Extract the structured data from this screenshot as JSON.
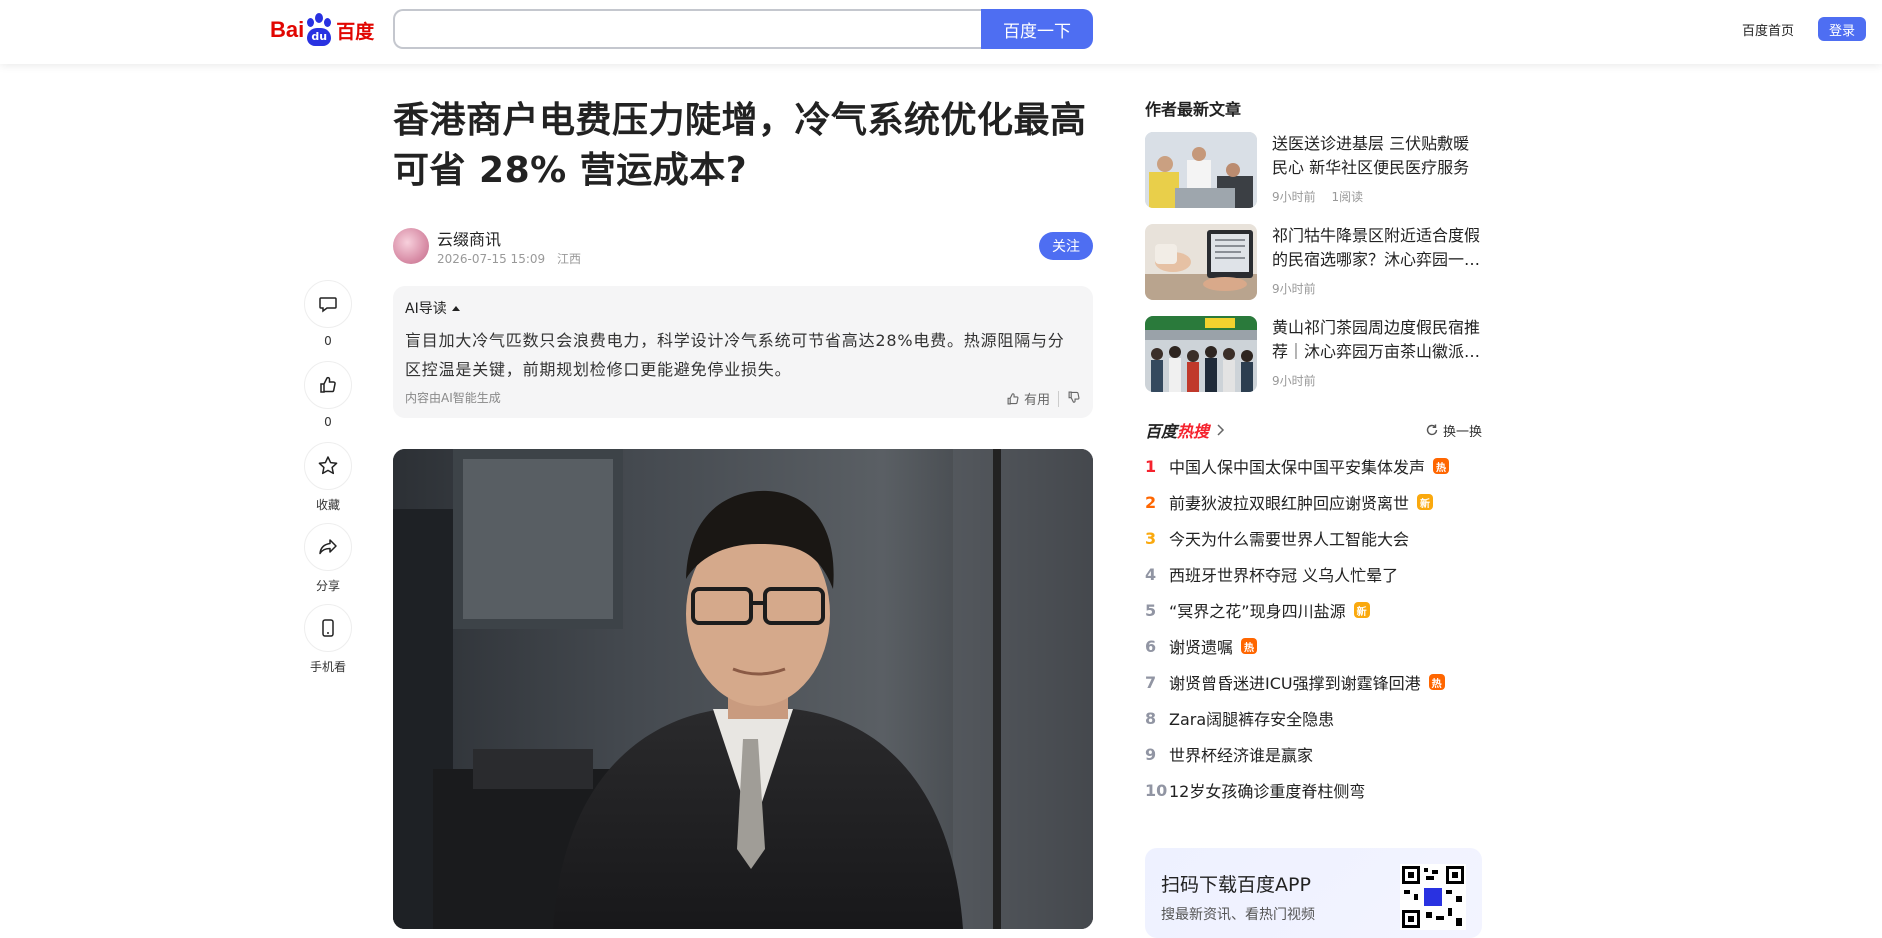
{
  "header": {
    "logo_text_left": "Bai",
    "logo_text_paw": "du",
    "logo_text_cn": "百度",
    "search_placeholder": "",
    "search_button": "百度一下",
    "home_link": "百度首页",
    "login_button": "登录"
  },
  "rail": [
    {
      "name": "comment",
      "label": "0"
    },
    {
      "name": "like",
      "label": "0"
    },
    {
      "name": "favorite",
      "label": "收藏"
    },
    {
      "name": "share",
      "label": "分享"
    },
    {
      "name": "mobile",
      "label": "手机看"
    }
  ],
  "article": {
    "title": "香港商户电费压力陡增，冷气系统优化最高可省 28% 营运成本?",
    "author": "云缀商讯",
    "date": "2026-07-15 15:09",
    "location": "江西",
    "follow_button": "关注",
    "ai": {
      "heading": "AI导读",
      "summary": "盲目加大冷气匹数只会浪费电力，科学设计冷气系统可节省高达28%电费。热源阻隔与分区控温是关键，前期规划检修口更能避免停业损失。",
      "footer": "内容由AI智能生成",
      "useful": "有用"
    }
  },
  "sidebar": {
    "latest_heading": "作者最新文章",
    "latest": [
      {
        "title": "送医送诊进基层 三伏贴敷暖民心 新华社区便民医疗服务",
        "time": "9小时前",
        "reads": "1阅读"
      },
      {
        "title": "祁门牯牛降景区附近适合度假的民宿选哪家？沐心弈园一站式",
        "time": "9小时前",
        "reads": ""
      },
      {
        "title": "黄山祁门茶园周边度假民宿推荐｜沐心弈园万亩茶山徽派民宿",
        "time": "9小时前",
        "reads": ""
      }
    ],
    "hot": {
      "brand_a": "百度",
      "brand_b": "热搜",
      "refresh": "换一换",
      "items": [
        {
          "rank": "1",
          "text": "中国人保中国太保中国平安集体发声",
          "badge": "热",
          "badge_type": "hot"
        },
        {
          "rank": "2",
          "text": "前妻狄波拉双眼红肿回应谢贤离世",
          "badge": "新",
          "badge_type": "new"
        },
        {
          "rank": "3",
          "text": "今天为什么需要世界人工智能大会",
          "badge": "",
          "badge_type": ""
        },
        {
          "rank": "4",
          "text": "西班牙世界杯夺冠 义乌人忙晕了",
          "badge": "",
          "badge_type": ""
        },
        {
          "rank": "5",
          "text": "“冥界之花”现身四川盐源",
          "badge": "新",
          "badge_type": "new"
        },
        {
          "rank": "6",
          "text": "谢贤遗嘱",
          "badge": "热",
          "badge_type": "hot"
        },
        {
          "rank": "7",
          "text": "谢贤曾昏迷进ICU强撑到谢霆锋回港",
          "badge": "热",
          "badge_type": "hot"
        },
        {
          "rank": "8",
          "text": "Zara阔腿裤存安全隐患",
          "badge": "",
          "badge_type": ""
        },
        {
          "rank": "9",
          "text": "世界杯经济谁是赢家",
          "badge": "",
          "badge_type": ""
        },
        {
          "rank": "10",
          "text": "12岁女孩确诊重度脊柱侧弯",
          "badge": "",
          "badge_type": ""
        }
      ]
    },
    "app": {
      "title": "扫码下载百度APP",
      "subtitle": "搜最新资讯、看热门视频"
    }
  },
  "colors": {
    "brand_blue": "#4e6ef2",
    "brand_red": "#e10601",
    "hot_orange": "#ff6600",
    "new_yellow": "#faa90e"
  }
}
